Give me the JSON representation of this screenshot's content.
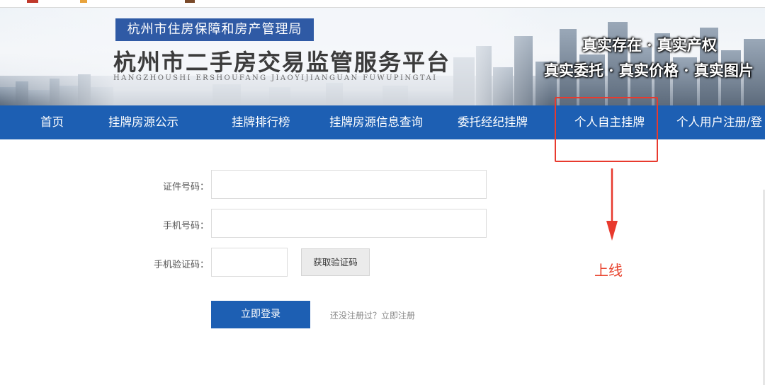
{
  "header": {
    "agency": "杭州市住房保障和房产管理局",
    "platform_title": "杭州市二手房交易监管服务平台",
    "pinyin": "HANGZHOUSHI ERSHOUFANG JIAOYIJIANGUAN FUWUPINGTAI",
    "slogan_line1": "真实存在 · 真实产权",
    "slogan_line2": "真实委托 · 真实价格 · 真实图片"
  },
  "nav": {
    "items": [
      {
        "label": "首页"
      },
      {
        "label": "挂牌房源公示"
      },
      {
        "label": "挂牌排行榜"
      },
      {
        "label": "挂牌房源信息查询"
      },
      {
        "label": "委托经纪挂牌"
      },
      {
        "label": "个人自主挂牌"
      },
      {
        "label": "个人用户注册/登"
      }
    ]
  },
  "form": {
    "id_label": "证件号码：",
    "id_value": "",
    "phone_label": "手机号码：",
    "phone_value": "",
    "code_label": "手机验证码：",
    "code_value": "",
    "get_code_button": "获取验证码",
    "login_button": "立即登录",
    "register_link": "还没注册过？立即注册"
  },
  "annotation": {
    "note": "上线"
  },
  "colors": {
    "nav_blue": "#1d5fb3",
    "agency_blue": "#2f5aa5",
    "annotation_red": "#e83a2e"
  }
}
